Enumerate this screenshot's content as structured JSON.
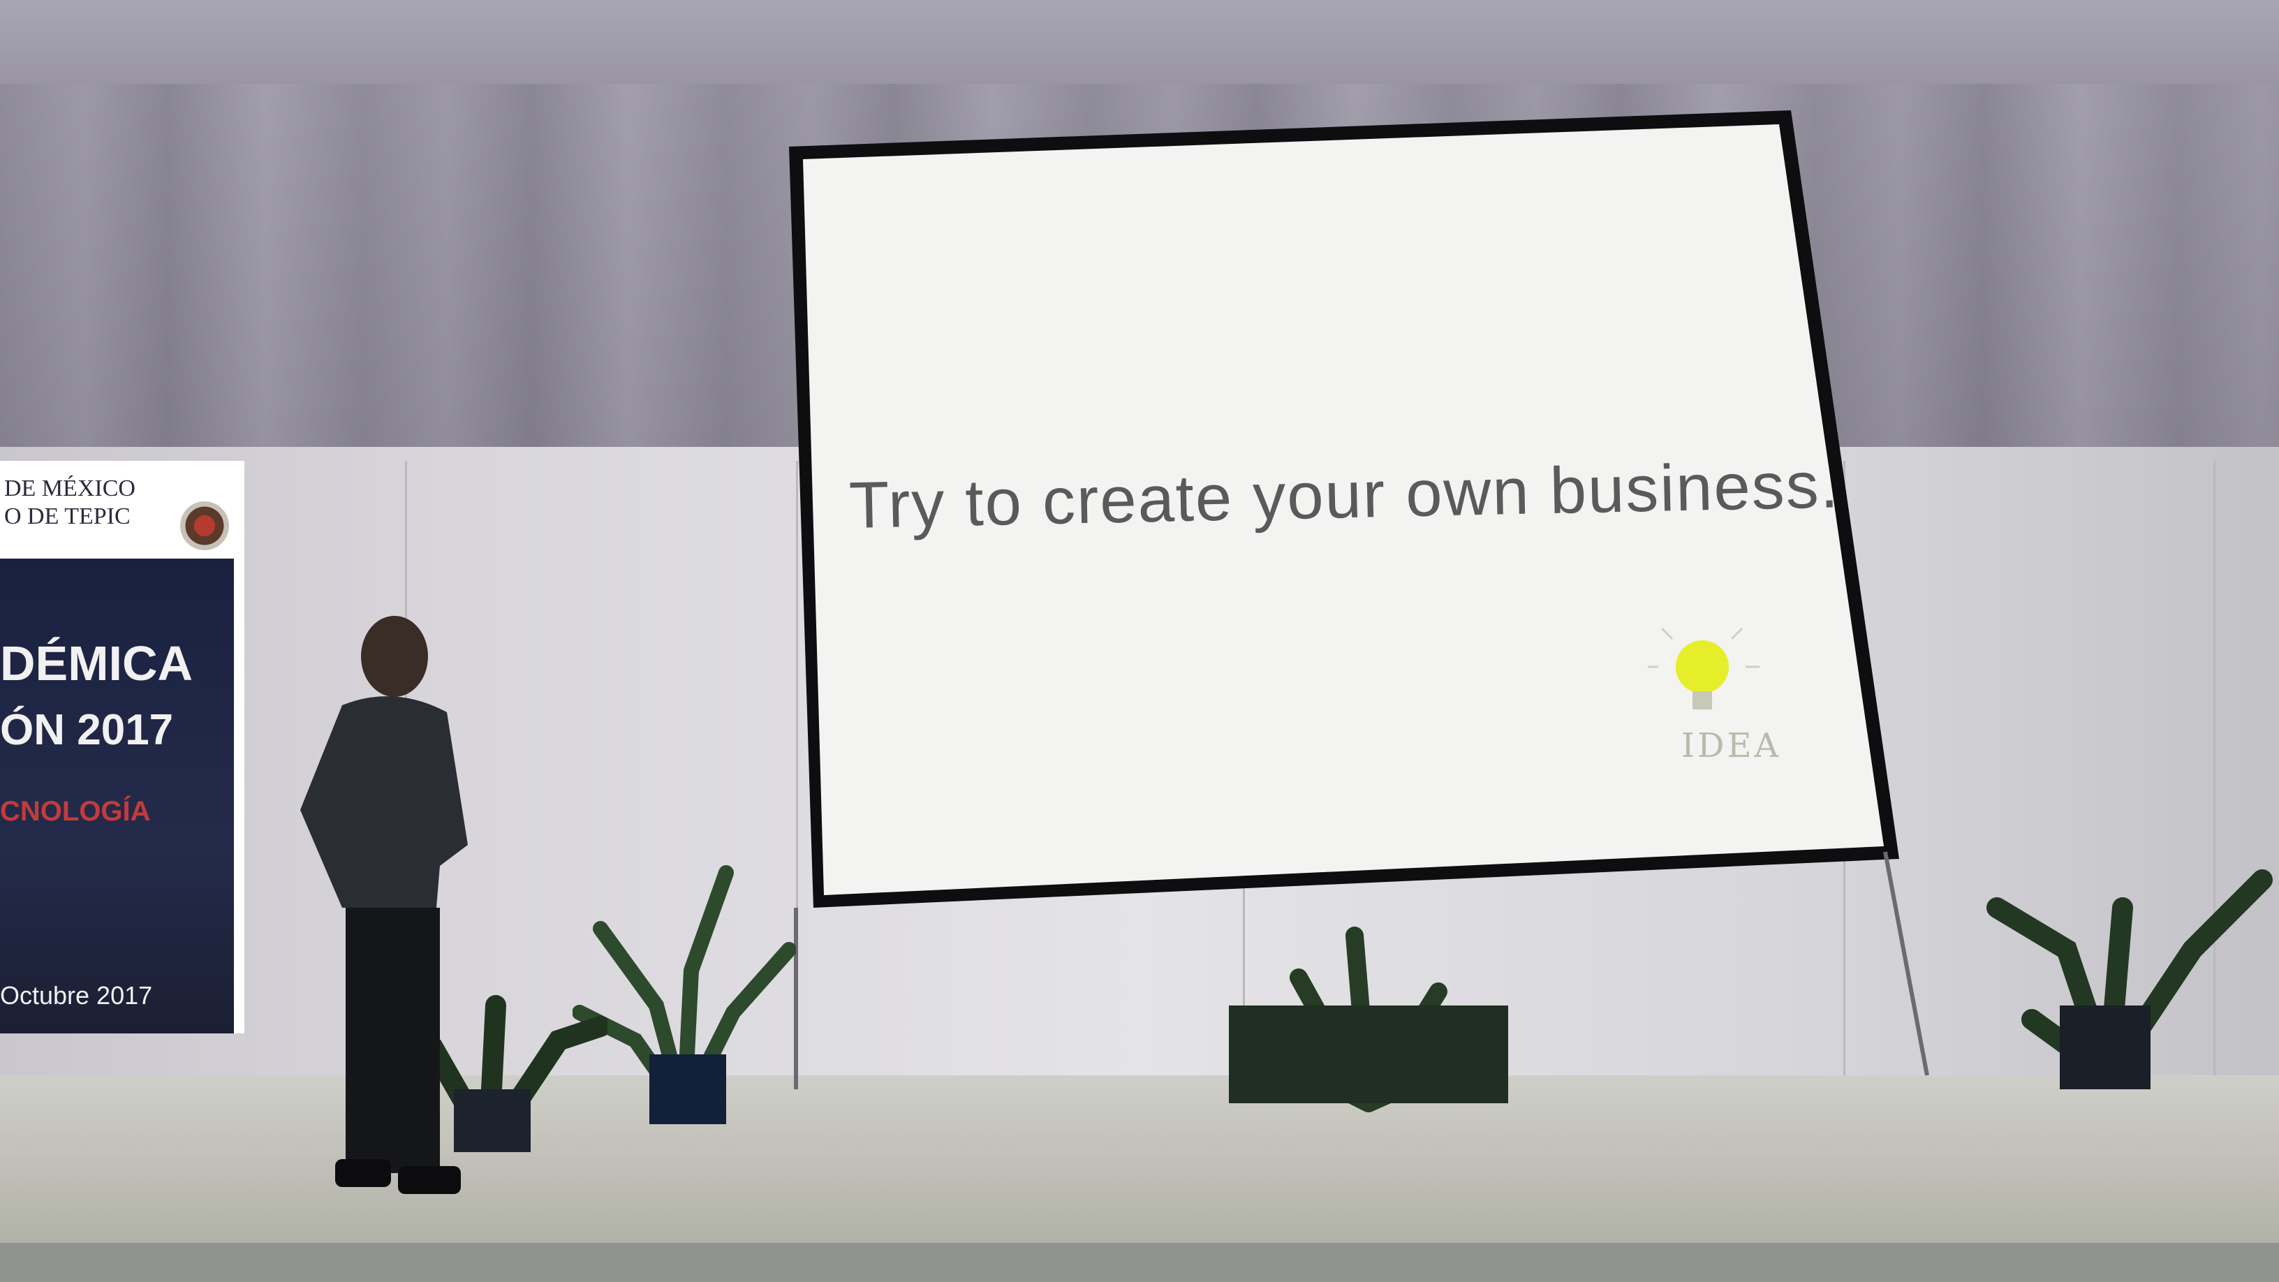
{
  "slide": {
    "text": "Try to create your own business.",
    "logo_caption": "IDEA",
    "logo_icon": "lightbulb-icon",
    "bulb_color": "#e6ee2a"
  },
  "banner": {
    "line1": "DE MÉXICO",
    "line2": "O DE TEPIC",
    "title1": "DÉMICA",
    "title2": "ÓN 2017",
    "title3": "CNOLOGÍA",
    "date": "Octubre 2017"
  }
}
